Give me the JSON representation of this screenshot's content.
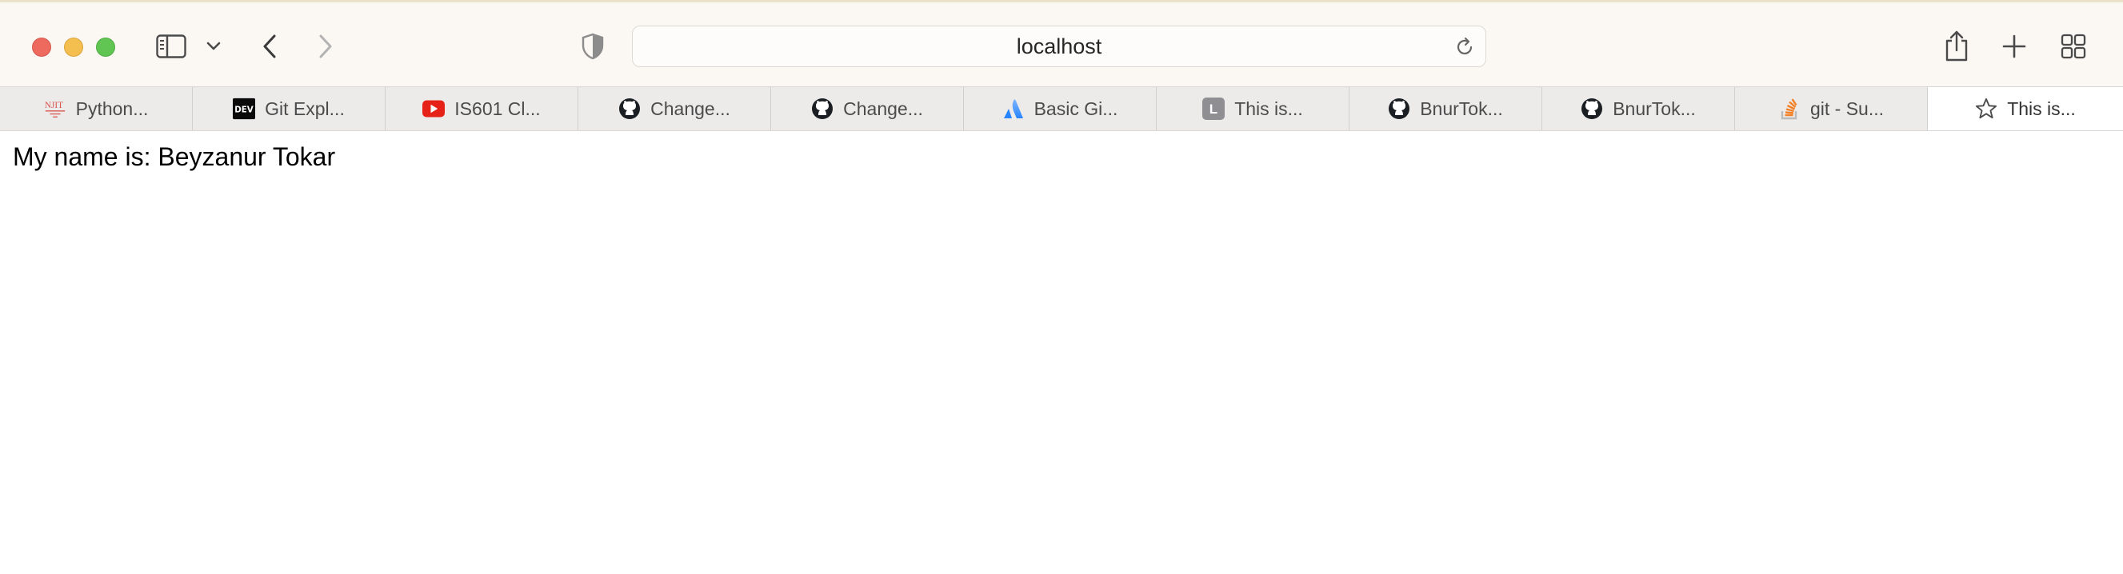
{
  "browser": {
    "address": "localhost",
    "buttons": {
      "sidebar": "sidebar-icon",
      "sidebar_menu": "chevron-down-icon",
      "back": "chevron-left-icon",
      "forward": "chevron-right-icon",
      "privacy": "shield-icon",
      "reload": "reload-icon",
      "share": "share-icon",
      "new_tab": "plus-icon",
      "tab_overview": "grid-icon"
    }
  },
  "tabs": [
    {
      "label": "Python...",
      "icon": "njit-icon",
      "active": false
    },
    {
      "label": "Git Expl...",
      "icon": "dev-icon",
      "active": false
    },
    {
      "label": "IS601 Cl...",
      "icon": "youtube-icon",
      "active": false
    },
    {
      "label": "Change...",
      "icon": "github-icon",
      "active": false
    },
    {
      "label": "Change...",
      "icon": "github-icon",
      "active": false
    },
    {
      "label": "Basic Gi...",
      "icon": "atlassian-icon",
      "active": false
    },
    {
      "label": "This is...",
      "icon": "letter-l-icon",
      "favicon_letter": "L",
      "active": false
    },
    {
      "label": "BnurTok...",
      "icon": "github-icon",
      "active": false
    },
    {
      "label": "BnurTok...",
      "icon": "github-icon",
      "active": false
    },
    {
      "label": "git - Su...",
      "icon": "stackoverflow-icon",
      "active": false
    },
    {
      "label": "This is...",
      "icon": "star-icon",
      "active": true
    }
  ],
  "page": {
    "text": "My name is: Beyzanur Tokar"
  },
  "colors": {
    "close": "#ee6a5f",
    "minimize": "#f5bf4f",
    "maximize": "#61c554",
    "youtube": "#e62117",
    "atlassian": "#2684ff",
    "stackoverflow": "#f48024"
  }
}
